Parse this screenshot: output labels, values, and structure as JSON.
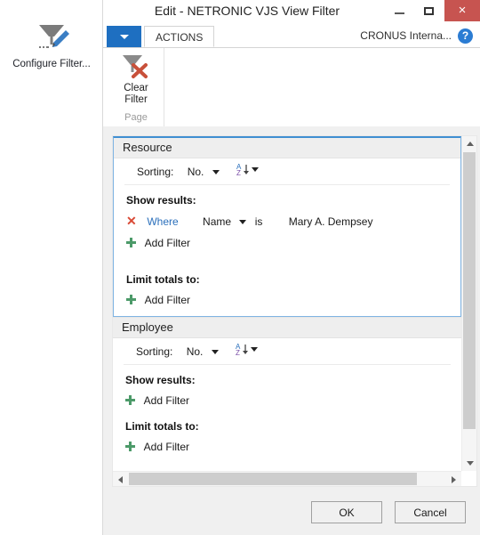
{
  "desktop": {
    "icon": {
      "name": "configure-filter-icon",
      "label": "Configure Filter..."
    }
  },
  "window": {
    "title": "Edit - NETRONIC VJS View Filter",
    "buttons": {
      "minimize": "minimize-icon",
      "maximize": "maximize-icon",
      "close": "×"
    }
  },
  "ribbon": {
    "dropdown_icon": "chevron-down-icon",
    "tabs": [
      {
        "label": "ACTIONS",
        "active": true
      }
    ],
    "company": "CRONUS Interna...",
    "help_icon": "?",
    "groups": [
      {
        "title": "Page",
        "buttons": [
          {
            "label_line1": "Clear",
            "label_line2": "Filter",
            "icon": "clear-filter-icon"
          }
        ]
      }
    ]
  },
  "filters": {
    "panes": [
      {
        "title": "Resource",
        "focused": true,
        "sorting": {
          "label": "Sorting:",
          "field": "No.",
          "order_icon": "sort-az-icon"
        },
        "show_results": {
          "label": "Show results:",
          "rows": [
            {
              "remove_icon": "✕",
              "keyword": "Where",
              "field": "Name",
              "operator": "is",
              "value": "Mary A. Dempsey"
            }
          ],
          "add_label": "Add Filter"
        },
        "limit_totals": {
          "label": "Limit totals to:",
          "rows": [],
          "add_label": "Add Filter"
        }
      },
      {
        "title": "Employee",
        "focused": false,
        "sorting": {
          "label": "Sorting:",
          "field": "No.",
          "order_icon": "sort-az-icon"
        },
        "show_results": {
          "label": "Show results:",
          "rows": [],
          "add_label": "Add Filter"
        },
        "limit_totals": {
          "label": "Limit totals to:",
          "rows": [],
          "add_label": "Add Filter"
        }
      }
    ]
  },
  "footer": {
    "ok_label": "OK",
    "cancel_label": "Cancel"
  },
  "colors": {
    "accent_blue": "#1e6fc1",
    "close_red": "#c75450",
    "link_blue": "#2a6fbb",
    "remove_red": "#d94a36",
    "plus_green": "#4c9a69",
    "focus_border": "#7fb4e3"
  }
}
